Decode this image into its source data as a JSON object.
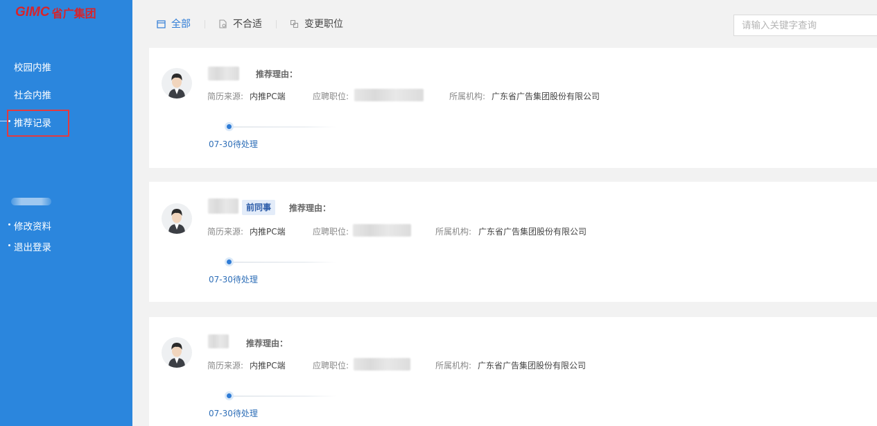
{
  "logo": {
    "mark": "GIMC",
    "name": "省广集团"
  },
  "sidebar": {
    "items": [
      {
        "label": "校园内推"
      },
      {
        "label": "社会内推"
      },
      {
        "label": "推荐记录"
      }
    ],
    "active_index": 2,
    "account_links": [
      {
        "label": "修改资料"
      },
      {
        "label": "退出登录"
      }
    ]
  },
  "tabs": [
    {
      "label": "全部",
      "icon": "calendar-icon"
    },
    {
      "label": "不合适",
      "icon": "document-icon"
    },
    {
      "label": "变更职位",
      "icon": "exchange-icon"
    }
  ],
  "search": {
    "placeholder": "请输入关键字查询",
    "value": ""
  },
  "labels": {
    "reason": "推荐理由：",
    "source": "简历来源:",
    "position": "应聘职位:",
    "org": "所属机构:"
  },
  "records": [
    {
      "tag": "",
      "source": "内推PC端",
      "org": "广东省广告集团股份有限公司",
      "status": "07-30待处理"
    },
    {
      "tag": "前同事",
      "source": "内推PC端",
      "org": "广东省广告集团股份有限公司",
      "status": "07-30待处理"
    },
    {
      "tag": "",
      "source": "内推PC端",
      "org": "广东省广告集团股份有限公司",
      "status": "07-30待处理"
    }
  ],
  "colors": {
    "sidebar": "#2b86dd",
    "accent": "#2f7cd6",
    "logo": "#d8232a",
    "highlight_box": "#e5393e"
  }
}
